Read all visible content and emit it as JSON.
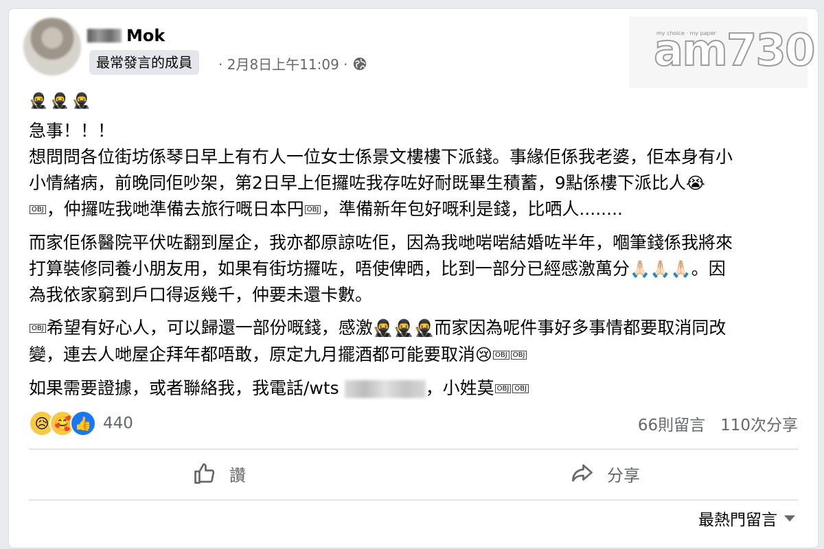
{
  "watermark": {
    "tagline": "my choice · my paper",
    "logo": "am730"
  },
  "post": {
    "author_suffix": "Mok",
    "member_badge": "最常發言的成員",
    "meta": "· 2月8日上午11:09 ·",
    "emoji_header": [
      "🥷",
      "🥷",
      "🥷"
    ],
    "p1_line1": "急事！！！",
    "p1_line2": "想問問各位街坊係琴日早上有冇人一位女士係景文樓樓下派錢。事緣佢係我老婆，佢本身有小",
    "p1_line3a": "小情緒病，前晚同佢吵架，第2日早上佢攞咗我存咗好耐既畢生積蓄，9點係樓下派比人",
    "p1_line3_emoji": "😭",
    "p1_line4a": "，仲攞咗我哋準備去旅行嘅日本円",
    "p1_line4b": "，準備新年包好嘅利是錢，比哂人........",
    "obj": "OBJ",
    "p2_line1": "而家佢係醫院平伏咗翻到屋企，我亦都原諒咗佢，因為我哋啱啱結婚咗半年，嗰筆錢係我將來",
    "p2_line2a": "打算裝修同養小朋友用，如果有街坊攞咗，唔使俾晒，比到一部分已經感激萬分",
    "p2_pray": [
      "🙏🏻",
      "🙏🏻",
      "🙏🏻"
    ],
    "p2_line2b": "。因",
    "p2_line3": "為我依家窮到戶口得返幾千，仲要未還卡數。",
    "p3_line1a": "希望有好心人，可以歸還一部份嘅錢，感激",
    "p3_ninjas": [
      "🥷",
      "🥷",
      "🥷"
    ],
    "p3_line1b": "而家因為呢件事好多事情都要取消同改",
    "p3_line2a": "變，連去人哋屋企拜年都唔敢，原定九月擺酒都可能要取消",
    "p3_cry": "😢",
    "p4_a": "如果需要證據，或者聯絡我，我電話/wts",
    "p4_b": "，小姓莫"
  },
  "reactions": {
    "icons": [
      "sad-reaction-icon",
      "care-reaction-icon",
      "like-reaction-icon"
    ],
    "sad_glyph": "😥",
    "care_glyph": "🥰",
    "like_glyph": "👍",
    "count": "440"
  },
  "stats": {
    "comments": "66則留言",
    "shares": "110次分享"
  },
  "actions": {
    "like_label": "讚",
    "share_label": "分享"
  },
  "comments_sort": {
    "label": "最熱門留言"
  }
}
